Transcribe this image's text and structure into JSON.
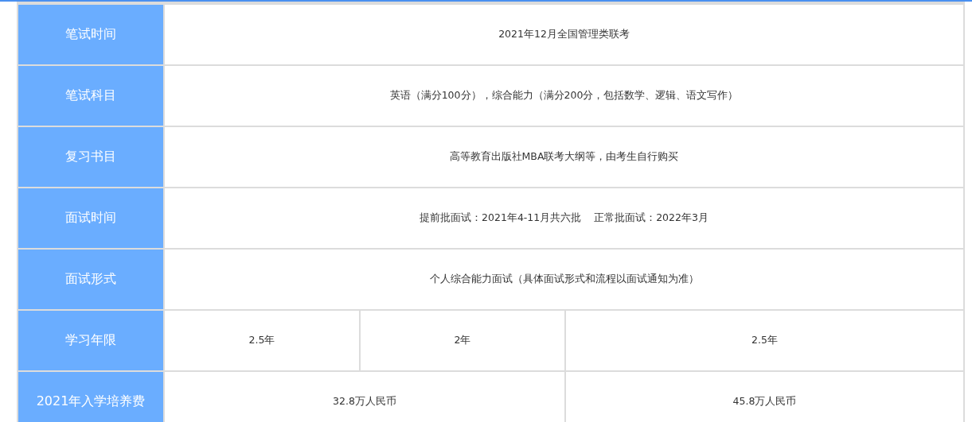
{
  "table": {
    "rows": [
      {
        "label": "笔试时间",
        "cells": [
          {
            "text": "2021年12月全国管理类联考",
            "colspan": 3
          }
        ]
      },
      {
        "label": "笔试科目",
        "cells": [
          {
            "text": "英语（满分100分），综合能力（满分200分，包括数学、逻辑、语文写作）",
            "colspan": 3
          }
        ]
      },
      {
        "label": "复习书目",
        "cells": [
          {
            "text": "高等教育出版社MBA联考大纲等，由考生自行购买",
            "colspan": 3
          }
        ]
      },
      {
        "label": "面试时间",
        "cells": [
          {
            "text": "提前批面试：2021年4-11月共六批    正常批面试：2022年3月",
            "colspan": 3
          }
        ]
      },
      {
        "label": "面试形式",
        "cells": [
          {
            "text": "个人综合能力面试（具体面试形式和流程以面试通知为准）",
            "colspan": 3
          }
        ]
      },
      {
        "label": "学习年限",
        "cells": [
          {
            "text": "2.5年"
          },
          {
            "text": "2年"
          },
          {
            "text": "2.5年"
          }
        ]
      },
      {
        "label": "2021年入学培养费",
        "cells": [
          {
            "text": "32.8万人民币",
            "colspan": 2
          },
          {
            "text": "45.8万人民币"
          }
        ]
      }
    ]
  }
}
